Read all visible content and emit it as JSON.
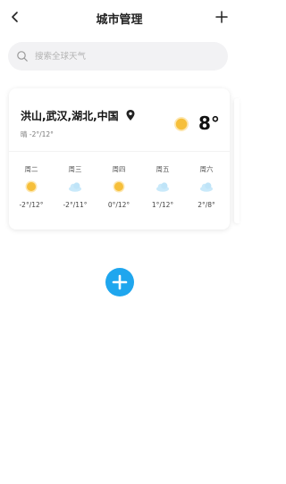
{
  "header": {
    "title": "城市管理"
  },
  "search": {
    "placeholder": "搜索全球天气"
  },
  "city": {
    "name": "洪山,武汉,湖北,中国",
    "condition": "晴 -2°/12°",
    "temperature": "8°",
    "forecast": [
      {
        "day": "周二",
        "range": "-2°/12°",
        "icon": "sun-icon"
      },
      {
        "day": "周三",
        "range": "-2°/11°",
        "icon": "cloud-icon"
      },
      {
        "day": "周四",
        "range": "0°/12°",
        "icon": "sun-icon"
      },
      {
        "day": "周五",
        "range": "1°/12°",
        "icon": "cloud-icon"
      },
      {
        "day": "周六",
        "range": "2°/8°",
        "icon": "cloud-icon"
      }
    ]
  },
  "colors": {
    "accent": "#1fa6ee",
    "sun": "#f6bf3a",
    "cloud": "#bfe4f8"
  }
}
